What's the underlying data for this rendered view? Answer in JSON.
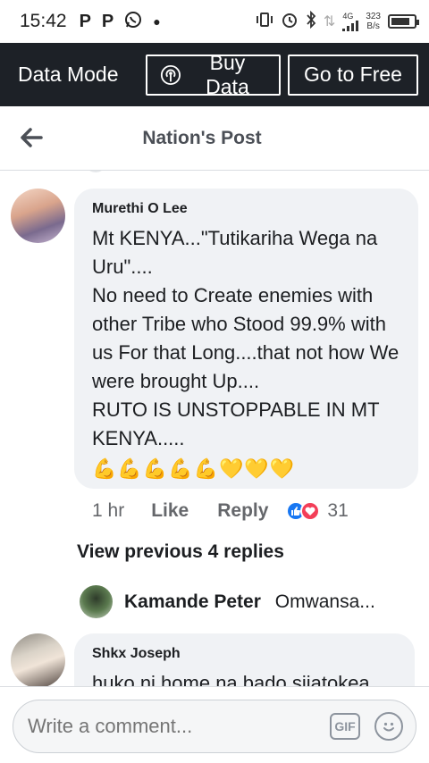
{
  "status_bar": {
    "time": "15:42",
    "icon_p1": "P",
    "icon_p2": "P",
    "net_type": "4G",
    "net_speed_value": "323",
    "net_speed_unit": "B/s",
    "battery_level": 0.85
  },
  "data_bar": {
    "mode_label": "Data Mode",
    "buy_label": "Buy Data",
    "free_label": "Go to Free"
  },
  "header": {
    "title": "Nation's Post"
  },
  "comment": {
    "author": "Murethi O Lee",
    "text": "Mt KENYA...\"Tutikariha Wega na Uru\"....\nNo need to Create enemies with other Tribe  who Stood 99.9% with us For that Long....that not how We were brought Up....\nRUTO IS UNSTOPPABLE IN MT KENYA.....",
    "emojis": "💪💪💪💪💪💛💛💛",
    "time": "1 hr",
    "like_label": "Like",
    "reply_label": "Reply",
    "reaction_count": "31"
  },
  "view_previous": "View previous 4 replies",
  "reply_preview": {
    "name": "Kamande Peter",
    "snippet": "Omwansa..."
  },
  "comment2": {
    "author": "Shkx Joseph",
    "text": "huko ni home na bado sijatokea"
  },
  "composer": {
    "placeholder": "Write a comment...",
    "gif_label": "GIF"
  }
}
